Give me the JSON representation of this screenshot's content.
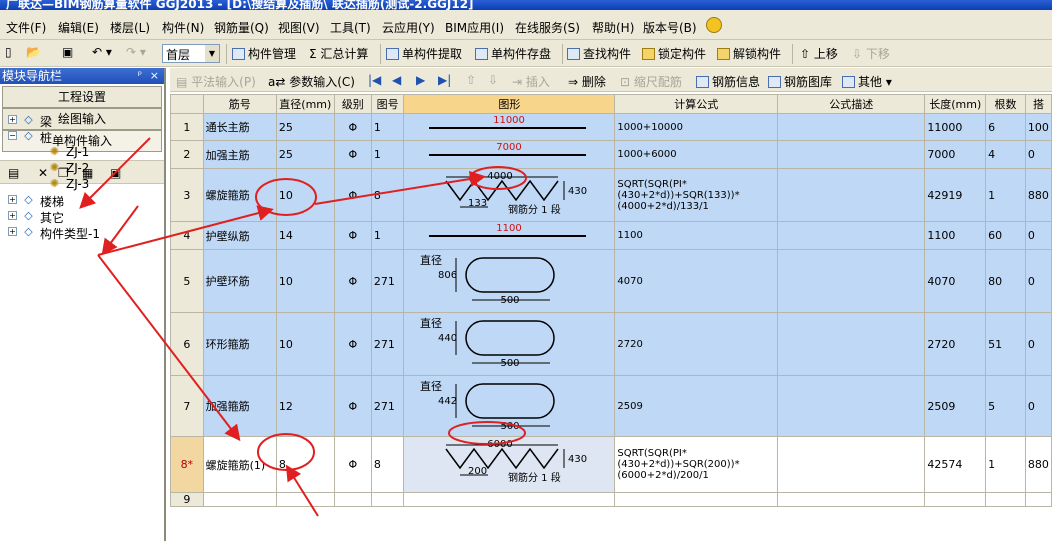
{
  "window": {
    "title": "广联达—BIM钢筋算量软件 GGJ2013 - [D:\\搜结算及插筋\\ 联达插筋(测试-2.GGJ12]"
  },
  "menu": [
    "文件(F)",
    "编辑(E)",
    "楼层(L)",
    "构件(N)",
    "钢筋量(Q)",
    "视图(V)",
    "工具(T)",
    "云应用(Y)",
    "BIM应用(I)",
    "在线服务(S)",
    "帮助(H)",
    "版本号(B)"
  ],
  "toolbar": {
    "floor": "首层",
    "buttons": [
      "构件管理",
      "Σ 汇总计算",
      "单构件提取",
      "单构件存盘",
      "查找构件",
      "锁定构件",
      "解锁构件",
      "上移",
      "下移"
    ]
  },
  "panel": {
    "title": "模块导航栏",
    "pin": "ᵖ",
    "close": "×",
    "nav": [
      "工程设置",
      "绘图输入",
      "单构件输入"
    ]
  },
  "tree": {
    "nodes": [
      {
        "label": "梁",
        "level": 0,
        "exp": "+"
      },
      {
        "label": "桩",
        "level": 0,
        "exp": "−"
      },
      {
        "label": "ZJ-1",
        "level": 1
      },
      {
        "label": "ZJ-2",
        "level": 1
      },
      {
        "label": "ZJ-3",
        "level": 1
      },
      {
        "label": "楼梯",
        "level": 0,
        "exp": "+"
      },
      {
        "label": "其它",
        "level": 0,
        "exp": "+"
      },
      {
        "label": "构件类型-1",
        "level": 0,
        "exp": "+"
      }
    ]
  },
  "gridtoolbar": [
    "平法输入(P)",
    "参数输入(C)",
    "插入",
    "删除",
    "缩尺配筋",
    "钢筋信息",
    "钢筋图库",
    "其他"
  ],
  "table": {
    "headers": [
      "筋号",
      "直径(mm)",
      "级别",
      "图号",
      "图形",
      "计算公式",
      "公式描述",
      "长度(mm)",
      "根数",
      "搭"
    ],
    "rows": [
      {
        "n": "1",
        "name": "通长主筋",
        "dia": "25",
        "grade": "Φ",
        "fig": "1",
        "shape": "line",
        "shape_txt": "11000",
        "formula": "1000+10000",
        "len": "11000",
        "cnt": "6",
        "lap": "100"
      },
      {
        "n": "2",
        "name": "加强主筋",
        "dia": "25",
        "grade": "Φ",
        "fig": "1",
        "shape": "line",
        "shape_txt": "7000",
        "formula": "1000+6000",
        "len": "7000",
        "cnt": "4",
        "lap": "0"
      },
      {
        "n": "3",
        "name": "螺旋箍筋",
        "dia": "10",
        "grade": "Φ",
        "fig": "8",
        "shape": "spiral",
        "shape_txt": "4000",
        "shape_h": "430",
        "shape_p": "133",
        "shape_seg": "钢筋分 1 段",
        "formula": "SQRT(SQR(PI*(430+2*d))+SQR(133))*(4000+2*d)/133/1",
        "len": "42919",
        "cnt": "1",
        "lap": "880"
      },
      {
        "n": "4",
        "name": "护壁纵筋",
        "dia": "14",
        "grade": "Φ",
        "fig": "1",
        "shape": "line",
        "shape_txt": "1100",
        "formula": "1100",
        "len": "1100",
        "cnt": "60",
        "lap": "0"
      },
      {
        "n": "5",
        "name": "护壁环筋",
        "dia": "10",
        "grade": "Φ",
        "fig": "271",
        "shape": "ring",
        "shape_lbl": "直径",
        "shape_d": "806",
        "shape_w": "500",
        "formula": "4070",
        "len": "4070",
        "cnt": "80",
        "lap": "0"
      },
      {
        "n": "6",
        "name": "环形箍筋",
        "dia": "10",
        "grade": "Φ",
        "fig": "271",
        "shape": "ring",
        "shape_lbl": "直径",
        "shape_d": "440",
        "shape_w": "500",
        "formula": "2720",
        "len": "2720",
        "cnt": "51",
        "lap": "0"
      },
      {
        "n": "7",
        "name": "加强箍筋",
        "dia": "12",
        "grade": "Φ",
        "fig": "271",
        "shape": "ring",
        "shape_lbl": "直径",
        "shape_d": "442",
        "shape_w": "500",
        "formula": "2509",
        "len": "2509",
        "cnt": "5",
        "lap": "0"
      },
      {
        "n": "8*",
        "name": "螺旋箍筋(1)",
        "dia": "8",
        "grade": "Φ",
        "fig": "8",
        "shape": "spiral",
        "shape_txt": "6000",
        "shape_h": "430",
        "shape_p": "200",
        "shape_seg": "钢筋分 1 段",
        "formula": "SQRT(SQR(PI*(430+2*d))+SQR(200))*(6000+2*d)/200/1",
        "len": "42574",
        "cnt": "1",
        "lap": "880"
      },
      {
        "n": "9",
        "name": "",
        "dia": "",
        "grade": "",
        "fig": "",
        "shape": "none",
        "formula": "",
        "len": "",
        "cnt": "",
        "lap": ""
      }
    ]
  },
  "colors": {
    "accent": "#e02020",
    "highlight": "#bfd8f5",
    "header": "#ece9d8"
  }
}
